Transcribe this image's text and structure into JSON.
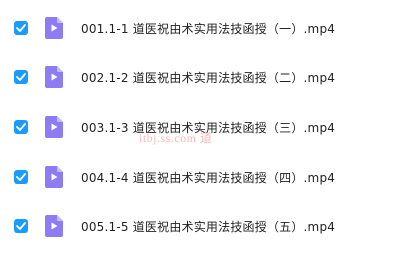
{
  "files": [
    {
      "name": "001.1-1 道医祝由术实用法技函授（一）.mp4",
      "checked": true,
      "icon": "video-file-icon"
    },
    {
      "name": "002.1-2 道医祝由术实用法技函授（二）.mp4",
      "checked": true,
      "icon": "video-file-icon"
    },
    {
      "name": "003.1-3 道医祝由术实用法技函授（三）.mp4",
      "checked": true,
      "icon": "video-file-icon"
    },
    {
      "name": "004.1-4 道医祝由术实用法技函授（四）.mp4",
      "checked": true,
      "icon": "video-file-icon"
    },
    {
      "name": "005.1-5 道医祝由术实用法技函授（五）.mp4",
      "checked": true,
      "icon": "video-file-icon"
    }
  ],
  "watermark": "itbj.ss.com 道",
  "colors": {
    "checkbox": "#1a9bff",
    "file_icon": "#8e7cf5",
    "file_icon_fold": "#c3b8fb",
    "text": "#222222"
  }
}
